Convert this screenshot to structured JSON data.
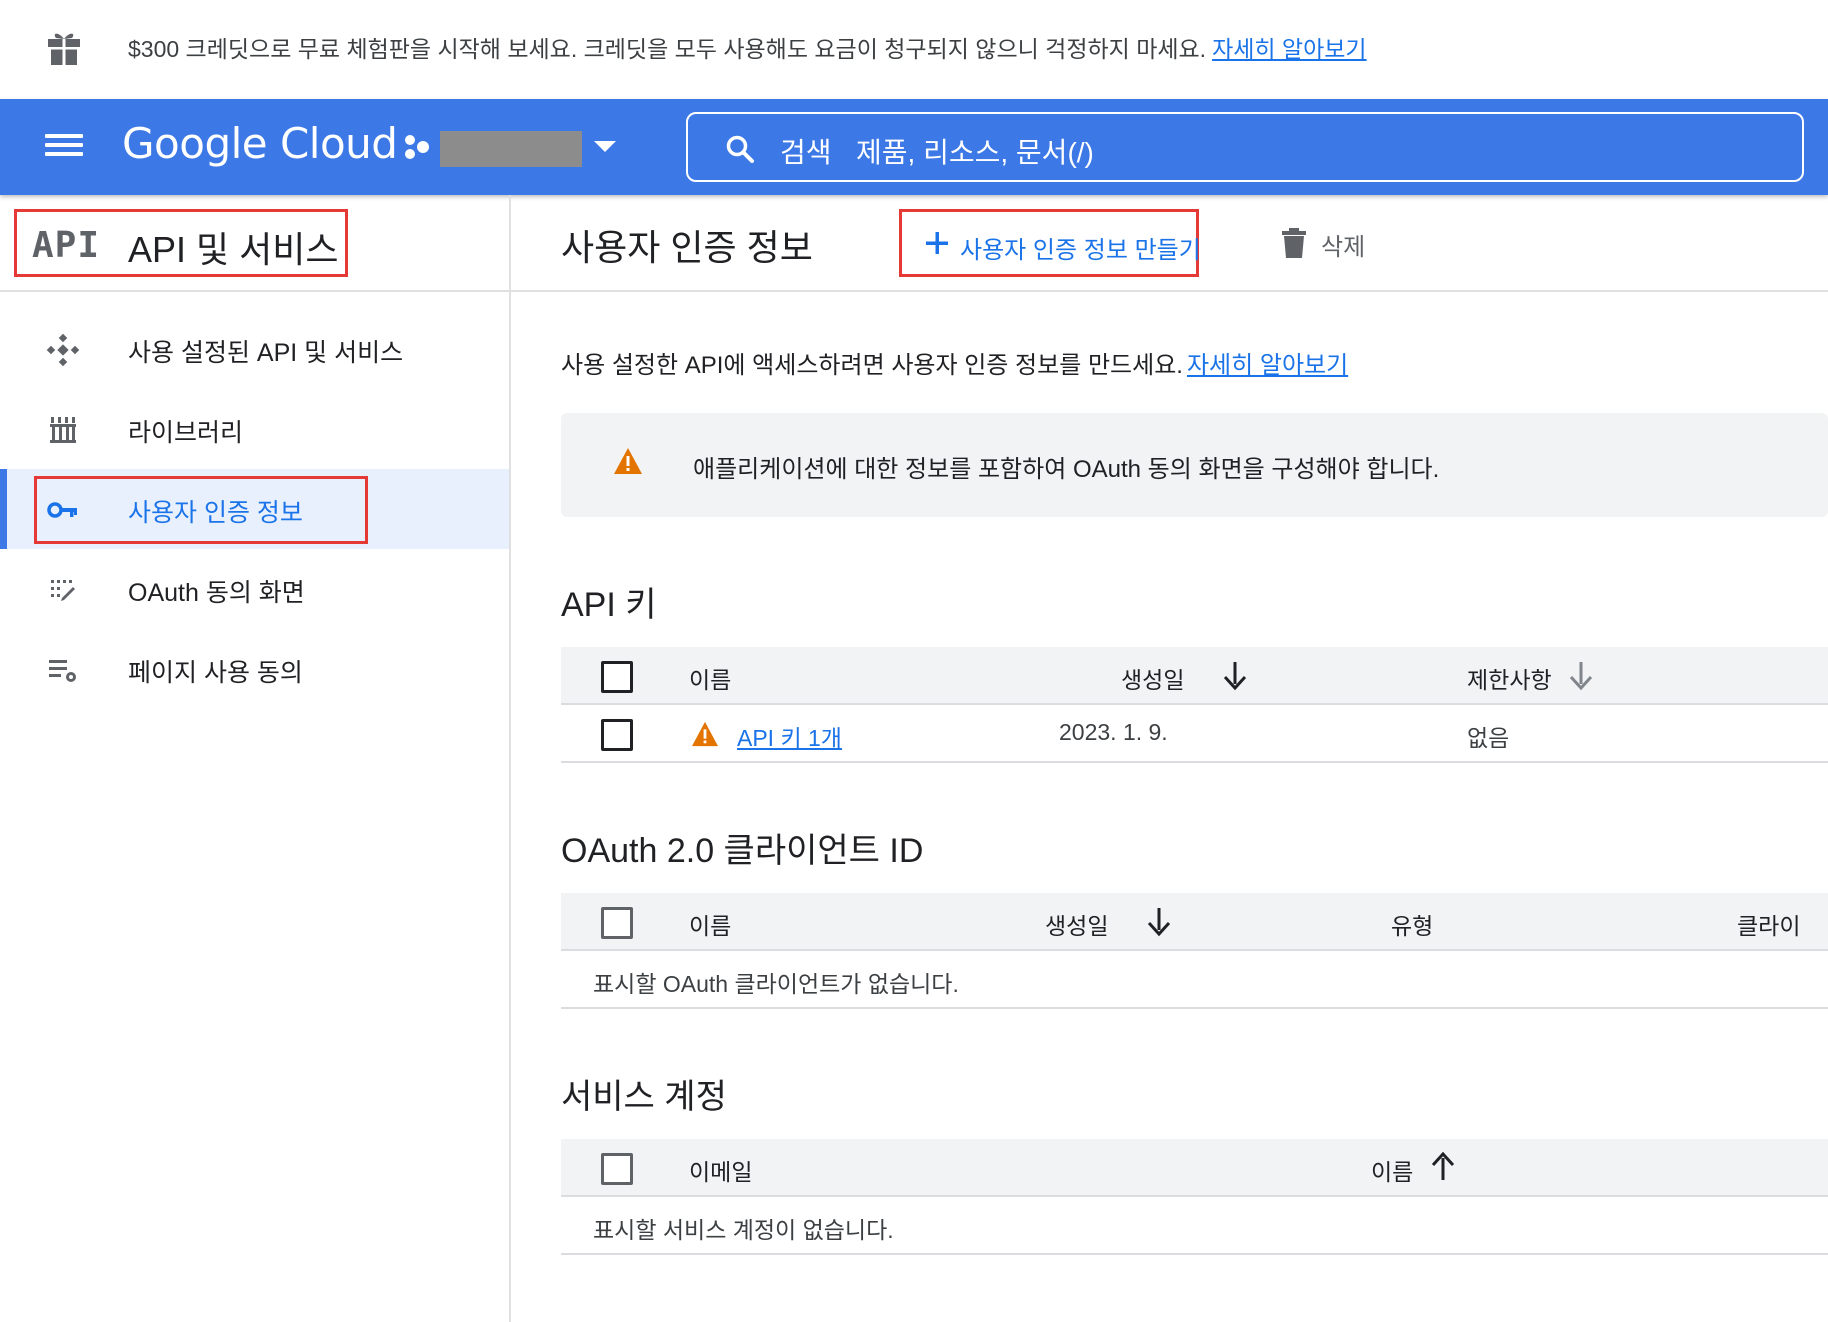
{
  "promo": {
    "icon": "gift-icon",
    "text": "$300 크레딧으로 무료 체험판을 시작해 보세요. 크레딧을 모두 사용해도 요금이 청구되지 않으니 걱정하지 마세요.",
    "link": "자세히 알아보기"
  },
  "topbar": {
    "brand": "Google Cloud",
    "search_label": "검색",
    "search_placeholder": "제품, 리소스, 문서(/)"
  },
  "sidebar": {
    "icon_text": "API",
    "title": "API 및 서비스",
    "items": [
      {
        "label": "사용 설정된 API 및 서비스",
        "icon": "enabled-apis-icon"
      },
      {
        "label": "라이브러리",
        "icon": "library-icon"
      },
      {
        "label": "사용자 인증 정보",
        "icon": "key-icon",
        "active": true
      },
      {
        "label": "OAuth 동의 화면",
        "icon": "consent-screen-icon"
      },
      {
        "label": "페이지 사용 동의",
        "icon": "page-usage-icon"
      }
    ]
  },
  "main": {
    "page_title": "사용자 인증 정보",
    "create_label": "사용자 인증 정보 만들기",
    "delete_label": "삭제",
    "intro_text": "사용 설정한 API에 액세스하려면 사용자 인증 정보를 만드세요.",
    "intro_link": "자세히 알아보기",
    "warning_text": "애플리케이션에 대한 정보를 포함하여 OAuth 동의 화면을 구성해야 합니다.",
    "api_keys": {
      "title": "API 키",
      "columns": [
        "이름",
        "생성일",
        "제한사항"
      ],
      "rows": [
        {
          "name": "API 키 1개",
          "created": "2023. 1. 9.",
          "restrictions": "없음"
        }
      ]
    },
    "oauth": {
      "title": "OAuth 2.0 클라이언트 ID",
      "columns": [
        "이름",
        "생성일",
        "유형",
        "클라이"
      ],
      "empty": "표시할 OAuth 클라이언트가 없습니다."
    },
    "service_accounts": {
      "title": "서비스 계정",
      "columns": [
        "이메일",
        "이름"
      ],
      "empty": "표시할 서비스 계정이 없습니다."
    }
  },
  "colors": {
    "topbar": "#3c78e6",
    "accent": "#1a73e8",
    "highlight_box": "#e53935",
    "warning": "#e37400"
  }
}
